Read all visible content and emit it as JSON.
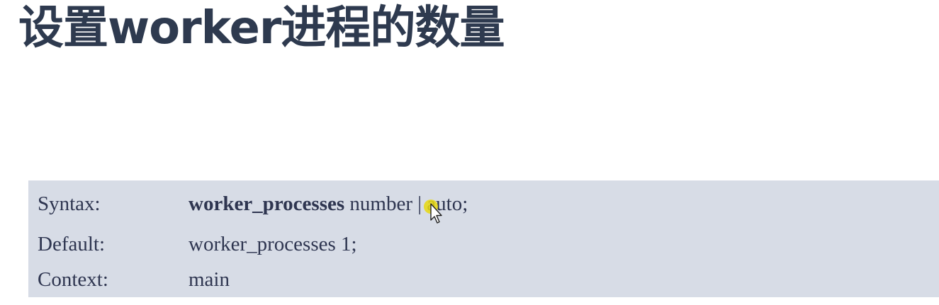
{
  "title": "设置worker进程的数量",
  "directive": {
    "syntax": {
      "label": "Syntax:",
      "name": "worker_processes",
      "args": "number | auto;"
    },
    "default": {
      "label": "Default:",
      "value": "worker_processes 1;"
    },
    "context": {
      "label": "Context:",
      "value": "main"
    }
  },
  "colors": {
    "title": "#2e3a4f",
    "box_background": "#d7dce6",
    "text": "#2e3550",
    "cursor_highlight": "#e8d80e"
  },
  "icons": {
    "cursor": "mouse-pointer-icon"
  }
}
